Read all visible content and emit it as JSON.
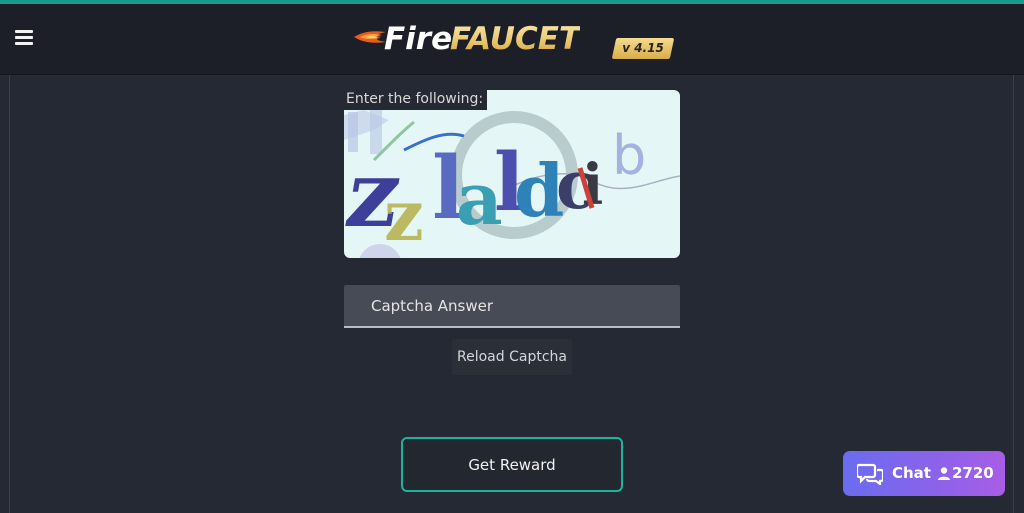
{
  "brand": {
    "fire": "Fire",
    "faucet": "FAUCET",
    "version": "v 4.15"
  },
  "captcha": {
    "label": "Enter the following:",
    "image_text": "zlaldci",
    "input_placeholder": "Captcha Answer",
    "reload_label": "Reload Captcha"
  },
  "actions": {
    "reward_label": "Get Reward"
  },
  "chat": {
    "label": "Chat",
    "online_count": "2720"
  },
  "icons": {
    "menu": "hamburger-menu-icon",
    "flame": "flame-icon",
    "chat": "chat-bubbles-icon",
    "user": "user-icon"
  },
  "colors": {
    "accent": "#1db49c",
    "background": "#252933",
    "navbar": "#1c1f27",
    "chat_gradient_start": "#6a6cf0",
    "chat_gradient_end": "#a85de6",
    "brand_gold": "#e8c467"
  }
}
